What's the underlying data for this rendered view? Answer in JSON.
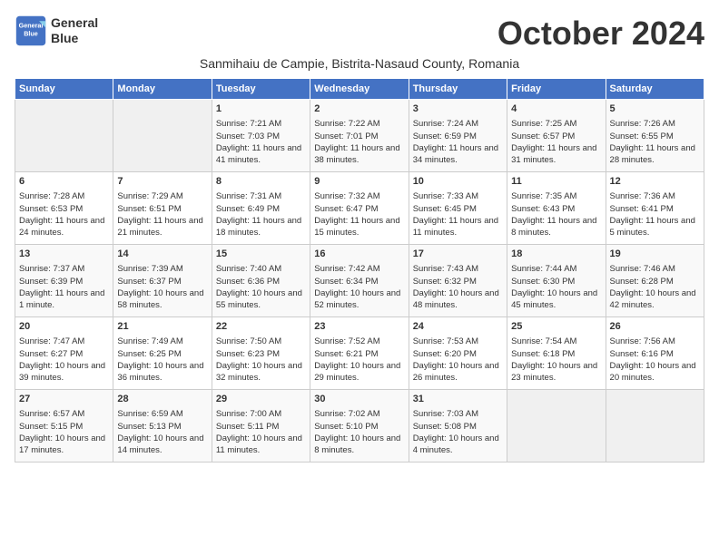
{
  "header": {
    "logo_line1": "General",
    "logo_line2": "Blue",
    "month_title": "October 2024",
    "subtitle": "Sanmihaiu de Campie, Bistrita-Nasaud County, Romania"
  },
  "columns": [
    "Sunday",
    "Monday",
    "Tuesday",
    "Wednesday",
    "Thursday",
    "Friday",
    "Saturday"
  ],
  "weeks": [
    [
      {
        "day": "",
        "data": ""
      },
      {
        "day": "",
        "data": ""
      },
      {
        "day": "1",
        "data": "Sunrise: 7:21 AM\nSunset: 7:03 PM\nDaylight: 11 hours and 41 minutes."
      },
      {
        "day": "2",
        "data": "Sunrise: 7:22 AM\nSunset: 7:01 PM\nDaylight: 11 hours and 38 minutes."
      },
      {
        "day": "3",
        "data": "Sunrise: 7:24 AM\nSunset: 6:59 PM\nDaylight: 11 hours and 34 minutes."
      },
      {
        "day": "4",
        "data": "Sunrise: 7:25 AM\nSunset: 6:57 PM\nDaylight: 11 hours and 31 minutes."
      },
      {
        "day": "5",
        "data": "Sunrise: 7:26 AM\nSunset: 6:55 PM\nDaylight: 11 hours and 28 minutes."
      }
    ],
    [
      {
        "day": "6",
        "data": "Sunrise: 7:28 AM\nSunset: 6:53 PM\nDaylight: 11 hours and 24 minutes."
      },
      {
        "day": "7",
        "data": "Sunrise: 7:29 AM\nSunset: 6:51 PM\nDaylight: 11 hours and 21 minutes."
      },
      {
        "day": "8",
        "data": "Sunrise: 7:31 AM\nSunset: 6:49 PM\nDaylight: 11 hours and 18 minutes."
      },
      {
        "day": "9",
        "data": "Sunrise: 7:32 AM\nSunset: 6:47 PM\nDaylight: 11 hours and 15 minutes."
      },
      {
        "day": "10",
        "data": "Sunrise: 7:33 AM\nSunset: 6:45 PM\nDaylight: 11 hours and 11 minutes."
      },
      {
        "day": "11",
        "data": "Sunrise: 7:35 AM\nSunset: 6:43 PM\nDaylight: 11 hours and 8 minutes."
      },
      {
        "day": "12",
        "data": "Sunrise: 7:36 AM\nSunset: 6:41 PM\nDaylight: 11 hours and 5 minutes."
      }
    ],
    [
      {
        "day": "13",
        "data": "Sunrise: 7:37 AM\nSunset: 6:39 PM\nDaylight: 11 hours and 1 minute."
      },
      {
        "day": "14",
        "data": "Sunrise: 7:39 AM\nSunset: 6:37 PM\nDaylight: 10 hours and 58 minutes."
      },
      {
        "day": "15",
        "data": "Sunrise: 7:40 AM\nSunset: 6:36 PM\nDaylight: 10 hours and 55 minutes."
      },
      {
        "day": "16",
        "data": "Sunrise: 7:42 AM\nSunset: 6:34 PM\nDaylight: 10 hours and 52 minutes."
      },
      {
        "day": "17",
        "data": "Sunrise: 7:43 AM\nSunset: 6:32 PM\nDaylight: 10 hours and 48 minutes."
      },
      {
        "day": "18",
        "data": "Sunrise: 7:44 AM\nSunset: 6:30 PM\nDaylight: 10 hours and 45 minutes."
      },
      {
        "day": "19",
        "data": "Sunrise: 7:46 AM\nSunset: 6:28 PM\nDaylight: 10 hours and 42 minutes."
      }
    ],
    [
      {
        "day": "20",
        "data": "Sunrise: 7:47 AM\nSunset: 6:27 PM\nDaylight: 10 hours and 39 minutes."
      },
      {
        "day": "21",
        "data": "Sunrise: 7:49 AM\nSunset: 6:25 PM\nDaylight: 10 hours and 36 minutes."
      },
      {
        "day": "22",
        "data": "Sunrise: 7:50 AM\nSunset: 6:23 PM\nDaylight: 10 hours and 32 minutes."
      },
      {
        "day": "23",
        "data": "Sunrise: 7:52 AM\nSunset: 6:21 PM\nDaylight: 10 hours and 29 minutes."
      },
      {
        "day": "24",
        "data": "Sunrise: 7:53 AM\nSunset: 6:20 PM\nDaylight: 10 hours and 26 minutes."
      },
      {
        "day": "25",
        "data": "Sunrise: 7:54 AM\nSunset: 6:18 PM\nDaylight: 10 hours and 23 minutes."
      },
      {
        "day": "26",
        "data": "Sunrise: 7:56 AM\nSunset: 6:16 PM\nDaylight: 10 hours and 20 minutes."
      }
    ],
    [
      {
        "day": "27",
        "data": "Sunrise: 6:57 AM\nSunset: 5:15 PM\nDaylight: 10 hours and 17 minutes."
      },
      {
        "day": "28",
        "data": "Sunrise: 6:59 AM\nSunset: 5:13 PM\nDaylight: 10 hours and 14 minutes."
      },
      {
        "day": "29",
        "data": "Sunrise: 7:00 AM\nSunset: 5:11 PM\nDaylight: 10 hours and 11 minutes."
      },
      {
        "day": "30",
        "data": "Sunrise: 7:02 AM\nSunset: 5:10 PM\nDaylight: 10 hours and 8 minutes."
      },
      {
        "day": "31",
        "data": "Sunrise: 7:03 AM\nSunset: 5:08 PM\nDaylight: 10 hours and 4 minutes."
      },
      {
        "day": "",
        "data": ""
      },
      {
        "day": "",
        "data": ""
      }
    ]
  ]
}
